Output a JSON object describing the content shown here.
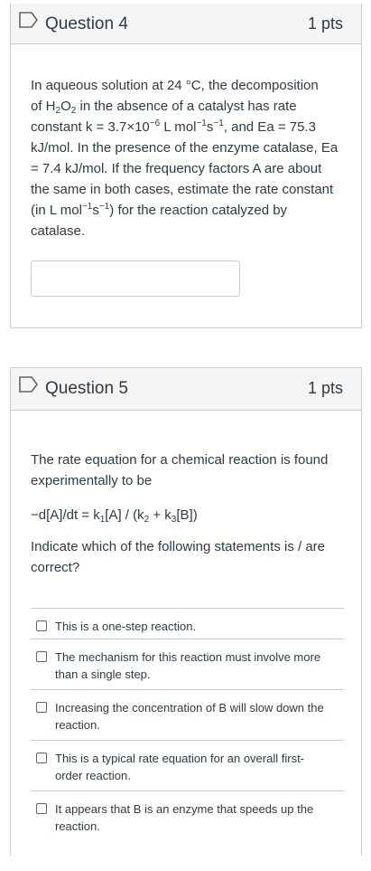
{
  "question4": {
    "title": "Question 4",
    "points": "1 pts",
    "text_lines": {
      "l1": "In aqueous solution at 24 °C, the decomposition",
      "l2_a": "of H",
      "l2_sub1": "2",
      "l2_b": "O",
      "l2_sub2": "2",
      "l2_c": " in the absence of a catalyst has rate",
      "l3_a": "constant k = 3.7×10",
      "l3_sup1": "−6",
      "l3_b": " L mol",
      "l3_sup2": "−1",
      "l3_c": "s",
      "l3_sup3": "−1",
      "l3_d": ", and Ea = 75.3",
      "l4": "kJ/mol. In the presence of the enzyme catalase, Ea",
      "l5": "= 7.4 kJ/mol. If the frequency factors A are about",
      "l6": "the same in both cases, estimate the rate constant",
      "l7_a": "(in L mol",
      "l7_sup1": "−1",
      "l7_b": "s",
      "l7_sup2": "−1",
      "l7_c": ") for the reaction catalyzed by",
      "l8": "catalase."
    },
    "answer_value": ""
  },
  "question5": {
    "title": "Question 5",
    "points": "1 pts",
    "intro_l1": "The rate equation for a chemical reaction is found",
    "intro_l2": "experimentally to be",
    "equation": {
      "a": "−d[A]/dt = k",
      "s1": "1",
      "b": "[A] / (k",
      "s2": "2",
      "c": " + k",
      "s3": "3",
      "d": "[B])"
    },
    "prompt_l1": "Indicate which of the following statements is / are",
    "prompt_l2": "correct?",
    "choices": [
      {
        "l1": "This is a one-step reaction.",
        "l2": ""
      },
      {
        "l1": "The mechanism for this reaction must involve more",
        "l2": "than a single step."
      },
      {
        "l1": "Increasing the concentration of B will slow down the",
        "l2": "reaction."
      },
      {
        "l1": "This is a typical rate equation for an overall first-",
        "l2": "order reaction."
      },
      {
        "l1": "It appears that B is an enzyme that speeds up the",
        "l2": "reaction."
      }
    ]
  }
}
